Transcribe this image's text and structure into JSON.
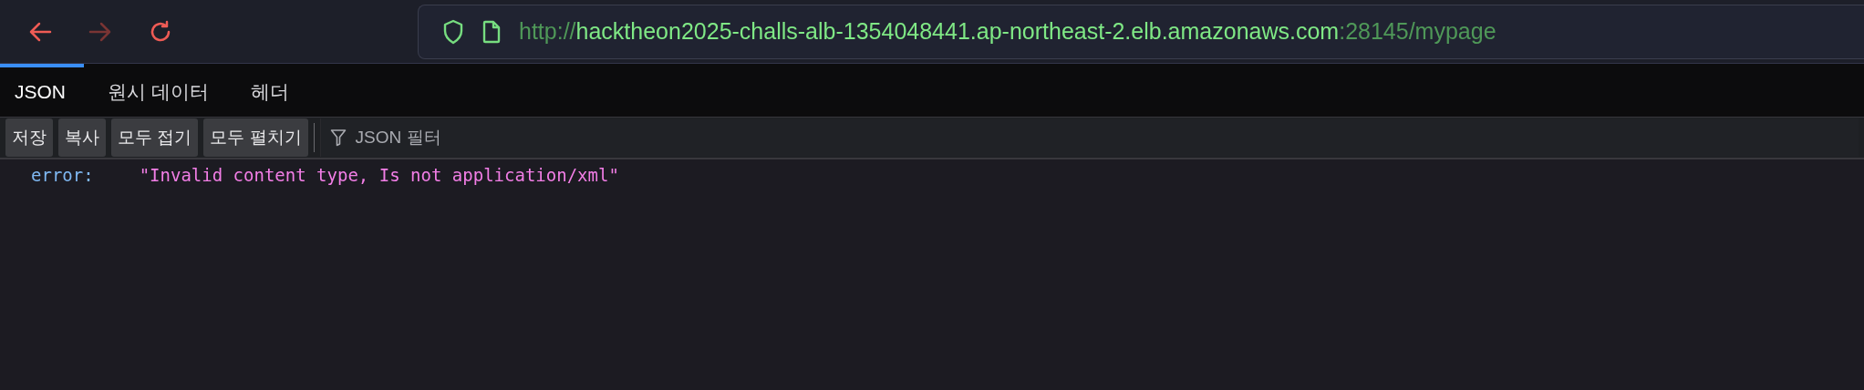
{
  "nav_buttons": [
    {
      "kind": "back",
      "disabled": false
    },
    {
      "kind": "forward",
      "disabled": true
    },
    {
      "kind": "reload",
      "disabled": false
    }
  ],
  "address_bar": {
    "url_scheme": "http://",
    "url_host": "hacktheon2025-challs-alb-1354048441.ap-northeast-2.elb.amazonaws.com",
    "url_rest": ":28145/mypage"
  },
  "tabs": [
    {
      "label": "JSON",
      "selected": true
    },
    {
      "label": "원시 데이터",
      "selected": false
    },
    {
      "label": "헤더",
      "selected": false
    }
  ],
  "toolbar": {
    "buttons": [
      "저장",
      "복사",
      "모두 접기",
      "모두 펼치기"
    ],
    "filter": {
      "placeholder": "JSON 필터"
    }
  },
  "json_rows": [
    {
      "key": "error:",
      "value": "\"Invalid content type, Is not application/xml\""
    }
  ]
}
